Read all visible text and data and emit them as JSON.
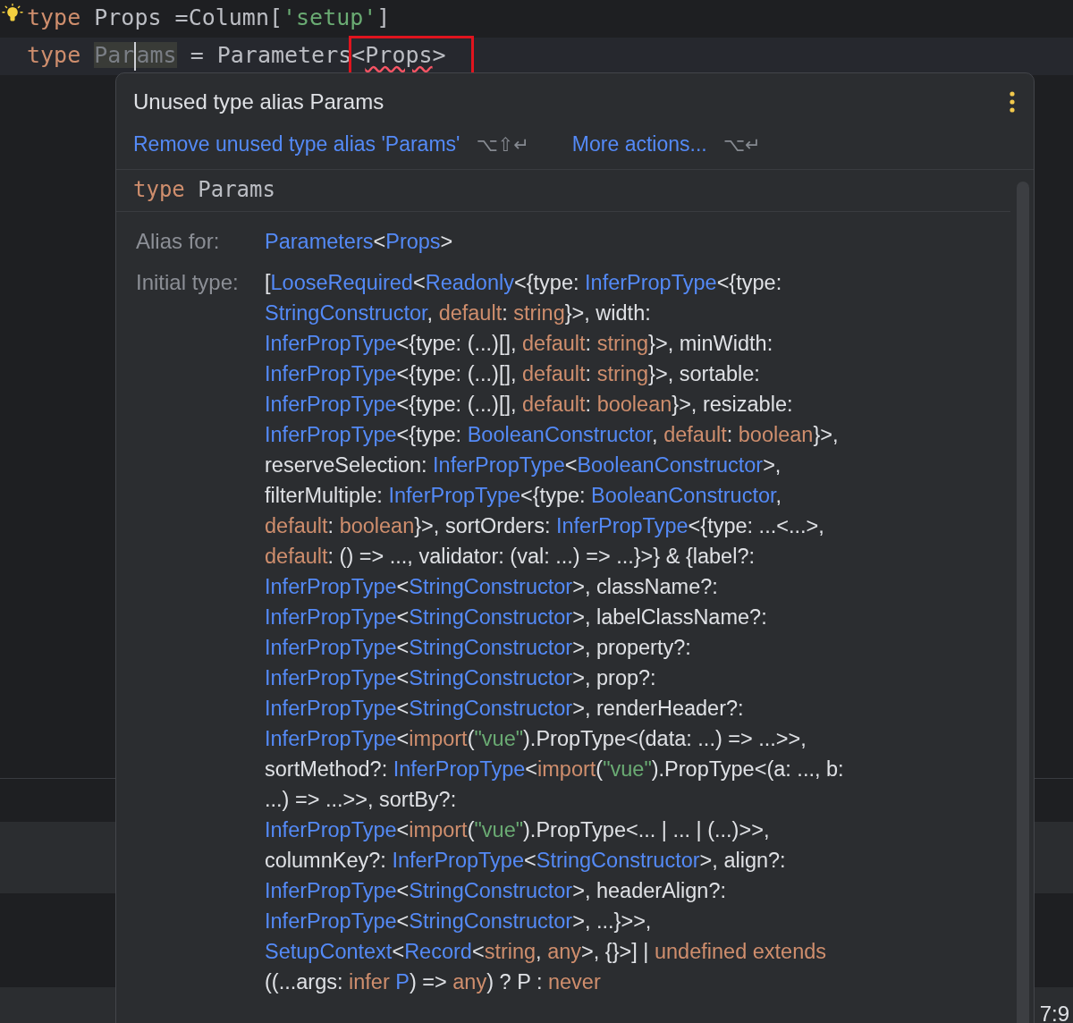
{
  "editor": {
    "lines": [
      {
        "current": false,
        "tokens": [
          {
            "kind": "keyword",
            "text": "type"
          },
          {
            "kind": "plain",
            "text": " Props =Column["
          },
          {
            "kind": "string",
            "text": "'setup'"
          },
          {
            "kind": "plain",
            "text": "]"
          }
        ]
      },
      {
        "current": true,
        "tokens": [
          {
            "kind": "keyword",
            "text": "type "
          },
          {
            "kind": "unused",
            "text": "Par",
            "caret": true
          },
          {
            "kind": "unused",
            "text": "ams"
          },
          {
            "kind": "plain",
            "text": " = Parameters"
          },
          {
            "kind": "annotated",
            "tokens": [
              {
                "kind": "plain",
                "text": "<"
              },
              {
                "kind": "error",
                "text": "Props"
              },
              {
                "kind": "plain",
                "text": ">"
              }
            ]
          }
        ]
      }
    ]
  },
  "popup": {
    "title": "Unused type alias Params",
    "actions": [
      {
        "label": "Remove unused type alias 'Params'",
        "shortcut": "⌥⇧↵"
      },
      {
        "label": "More actions...",
        "shortcut": "⌥↵"
      }
    ],
    "declaration": {
      "keyword": "type",
      "name": "Params"
    },
    "fields": [
      {
        "label": "Alias for:",
        "lines": [
          [
            {
              "kind": "type",
              "text": "Parameters"
            },
            {
              "kind": "plain",
              "text": "<"
            },
            {
              "kind": "type",
              "text": "Props"
            },
            {
              "kind": "plain",
              "text": ">"
            }
          ]
        ]
      },
      {
        "label": "Initial type:",
        "lines": [
          [
            {
              "kind": "plain",
              "text": "["
            },
            {
              "kind": "type",
              "text": "LooseRequired"
            },
            {
              "kind": "plain",
              "text": "<"
            },
            {
              "kind": "type",
              "text": "Readonly"
            },
            {
              "kind": "plain",
              "text": "<{type: "
            },
            {
              "kind": "type",
              "text": "InferPropType"
            },
            {
              "kind": "plain",
              "text": "<{type:"
            }
          ],
          [
            {
              "kind": "type",
              "text": "StringConstructor"
            },
            {
              "kind": "plain",
              "text": ", "
            },
            {
              "kind": "keyword",
              "text": "default"
            },
            {
              "kind": "plain",
              "text": ": "
            },
            {
              "kind": "keyword",
              "text": "string"
            },
            {
              "kind": "plain",
              "text": "}>, width:"
            }
          ],
          [
            {
              "kind": "type",
              "text": "InferPropType"
            },
            {
              "kind": "plain",
              "text": "<{type: (...)[], "
            },
            {
              "kind": "keyword",
              "text": "default"
            },
            {
              "kind": "plain",
              "text": ": "
            },
            {
              "kind": "keyword",
              "text": "string"
            },
            {
              "kind": "plain",
              "text": "}>, minWidth:"
            }
          ],
          [
            {
              "kind": "type",
              "text": "InferPropType"
            },
            {
              "kind": "plain",
              "text": "<{type: (...)[], "
            },
            {
              "kind": "keyword",
              "text": "default"
            },
            {
              "kind": "plain",
              "text": ": "
            },
            {
              "kind": "keyword",
              "text": "string"
            },
            {
              "kind": "plain",
              "text": "}>, sortable:"
            }
          ],
          [
            {
              "kind": "type",
              "text": "InferPropType"
            },
            {
              "kind": "plain",
              "text": "<{type: (...)[], "
            },
            {
              "kind": "keyword",
              "text": "default"
            },
            {
              "kind": "plain",
              "text": ": "
            },
            {
              "kind": "keyword",
              "text": "boolean"
            },
            {
              "kind": "plain",
              "text": "}>, resizable:"
            }
          ],
          [
            {
              "kind": "type",
              "text": "InferPropType"
            },
            {
              "kind": "plain",
              "text": "<{type: "
            },
            {
              "kind": "type",
              "text": "BooleanConstructor"
            },
            {
              "kind": "plain",
              "text": ", "
            },
            {
              "kind": "keyword",
              "text": "default"
            },
            {
              "kind": "plain",
              "text": ": "
            },
            {
              "kind": "keyword",
              "text": "boolean"
            },
            {
              "kind": "plain",
              "text": "}>,"
            }
          ],
          [
            {
              "kind": "plain",
              "text": "reserveSelection: "
            },
            {
              "kind": "type",
              "text": "InferPropType"
            },
            {
              "kind": "plain",
              "text": "<"
            },
            {
              "kind": "type",
              "text": "BooleanConstructor"
            },
            {
              "kind": "plain",
              "text": ">,"
            }
          ],
          [
            {
              "kind": "plain",
              "text": "filterMultiple: "
            },
            {
              "kind": "type",
              "text": "InferPropType"
            },
            {
              "kind": "plain",
              "text": "<{type: "
            },
            {
              "kind": "type",
              "text": "BooleanConstructor"
            },
            {
              "kind": "plain",
              "text": ","
            }
          ],
          [
            {
              "kind": "keyword",
              "text": "default"
            },
            {
              "kind": "plain",
              "text": ": "
            },
            {
              "kind": "keyword",
              "text": "boolean"
            },
            {
              "kind": "plain",
              "text": "}>, sortOrders: "
            },
            {
              "kind": "type",
              "text": "InferPropType"
            },
            {
              "kind": "plain",
              "text": "<{type: ...<...>,"
            }
          ],
          [
            {
              "kind": "keyword",
              "text": "default"
            },
            {
              "kind": "plain",
              "text": ": () => ..., validator: (val: ...) => ...}>} & {label?:"
            }
          ],
          [
            {
              "kind": "type",
              "text": "InferPropType"
            },
            {
              "kind": "plain",
              "text": "<"
            },
            {
              "kind": "type",
              "text": "StringConstructor"
            },
            {
              "kind": "plain",
              "text": ">, className?:"
            }
          ],
          [
            {
              "kind": "type",
              "text": "InferPropType"
            },
            {
              "kind": "plain",
              "text": "<"
            },
            {
              "kind": "type",
              "text": "StringConstructor"
            },
            {
              "kind": "plain",
              "text": ">, labelClassName?:"
            }
          ],
          [
            {
              "kind": "type",
              "text": "InferPropType"
            },
            {
              "kind": "plain",
              "text": "<"
            },
            {
              "kind": "type",
              "text": "StringConstructor"
            },
            {
              "kind": "plain",
              "text": ">, property?:"
            }
          ],
          [
            {
              "kind": "type",
              "text": "InferPropType"
            },
            {
              "kind": "plain",
              "text": "<"
            },
            {
              "kind": "type",
              "text": "StringConstructor"
            },
            {
              "kind": "plain",
              "text": ">, prop?:"
            }
          ],
          [
            {
              "kind": "type",
              "text": "InferPropType"
            },
            {
              "kind": "plain",
              "text": "<"
            },
            {
              "kind": "type",
              "text": "StringConstructor"
            },
            {
              "kind": "plain",
              "text": ">, renderHeader?:"
            }
          ],
          [
            {
              "kind": "type",
              "text": "InferPropType"
            },
            {
              "kind": "plain",
              "text": "<"
            },
            {
              "kind": "keyword",
              "text": "import"
            },
            {
              "kind": "plain",
              "text": "("
            },
            {
              "kind": "string",
              "text": "\"vue\""
            },
            {
              "kind": "plain",
              "text": ").PropType<(data: ...) => ...>>,"
            }
          ],
          [
            {
              "kind": "plain",
              "text": "sortMethod?: "
            },
            {
              "kind": "type",
              "text": "InferPropType"
            },
            {
              "kind": "plain",
              "text": "<"
            },
            {
              "kind": "keyword",
              "text": "import"
            },
            {
              "kind": "plain",
              "text": "("
            },
            {
              "kind": "string",
              "text": "\"vue\""
            },
            {
              "kind": "plain",
              "text": ").PropType<(a: ..., b:"
            }
          ],
          [
            {
              "kind": "plain",
              "text": "...) => ...>>, sortBy?:"
            }
          ],
          [
            {
              "kind": "type",
              "text": "InferPropType"
            },
            {
              "kind": "plain",
              "text": "<"
            },
            {
              "kind": "keyword",
              "text": "import"
            },
            {
              "kind": "plain",
              "text": "("
            },
            {
              "kind": "string",
              "text": "\"vue\""
            },
            {
              "kind": "plain",
              "text": ").PropType<... | ... | (...)>>,"
            }
          ],
          [
            {
              "kind": "plain",
              "text": "columnKey?: "
            },
            {
              "kind": "type",
              "text": "InferPropType"
            },
            {
              "kind": "plain",
              "text": "<"
            },
            {
              "kind": "type",
              "text": "StringConstructor"
            },
            {
              "kind": "plain",
              "text": ">, align?:"
            }
          ],
          [
            {
              "kind": "type",
              "text": "InferPropType"
            },
            {
              "kind": "plain",
              "text": "<"
            },
            {
              "kind": "type",
              "text": "StringConstructor"
            },
            {
              "kind": "plain",
              "text": ">, headerAlign?:"
            }
          ],
          [
            {
              "kind": "type",
              "text": "InferPropType"
            },
            {
              "kind": "plain",
              "text": "<"
            },
            {
              "kind": "type",
              "text": "StringConstructor"
            },
            {
              "kind": "plain",
              "text": ">, ...}>>,"
            }
          ],
          [
            {
              "kind": "type",
              "text": "SetupContext"
            },
            {
              "kind": "plain",
              "text": "<"
            },
            {
              "kind": "type",
              "text": "Record"
            },
            {
              "kind": "plain",
              "text": "<"
            },
            {
              "kind": "keyword",
              "text": "string"
            },
            {
              "kind": "plain",
              "text": ", "
            },
            {
              "kind": "keyword",
              "text": "any"
            },
            {
              "kind": "plain",
              "text": ">, {}>] | "
            },
            {
              "kind": "keyword",
              "text": "undefined extends"
            }
          ],
          [
            {
              "kind": "plain",
              "text": "((...args: "
            },
            {
              "kind": "keyword",
              "text": "infer "
            },
            {
              "kind": "type",
              "text": "P"
            },
            {
              "kind": "plain",
              "text": ") => "
            },
            {
              "kind": "keyword",
              "text": "any"
            },
            {
              "kind": "plain",
              "text": ") ? P : "
            },
            {
              "kind": "keyword",
              "text": "never"
            }
          ]
        ]
      }
    ]
  },
  "status_bar": {
    "position": "7:9"
  }
}
